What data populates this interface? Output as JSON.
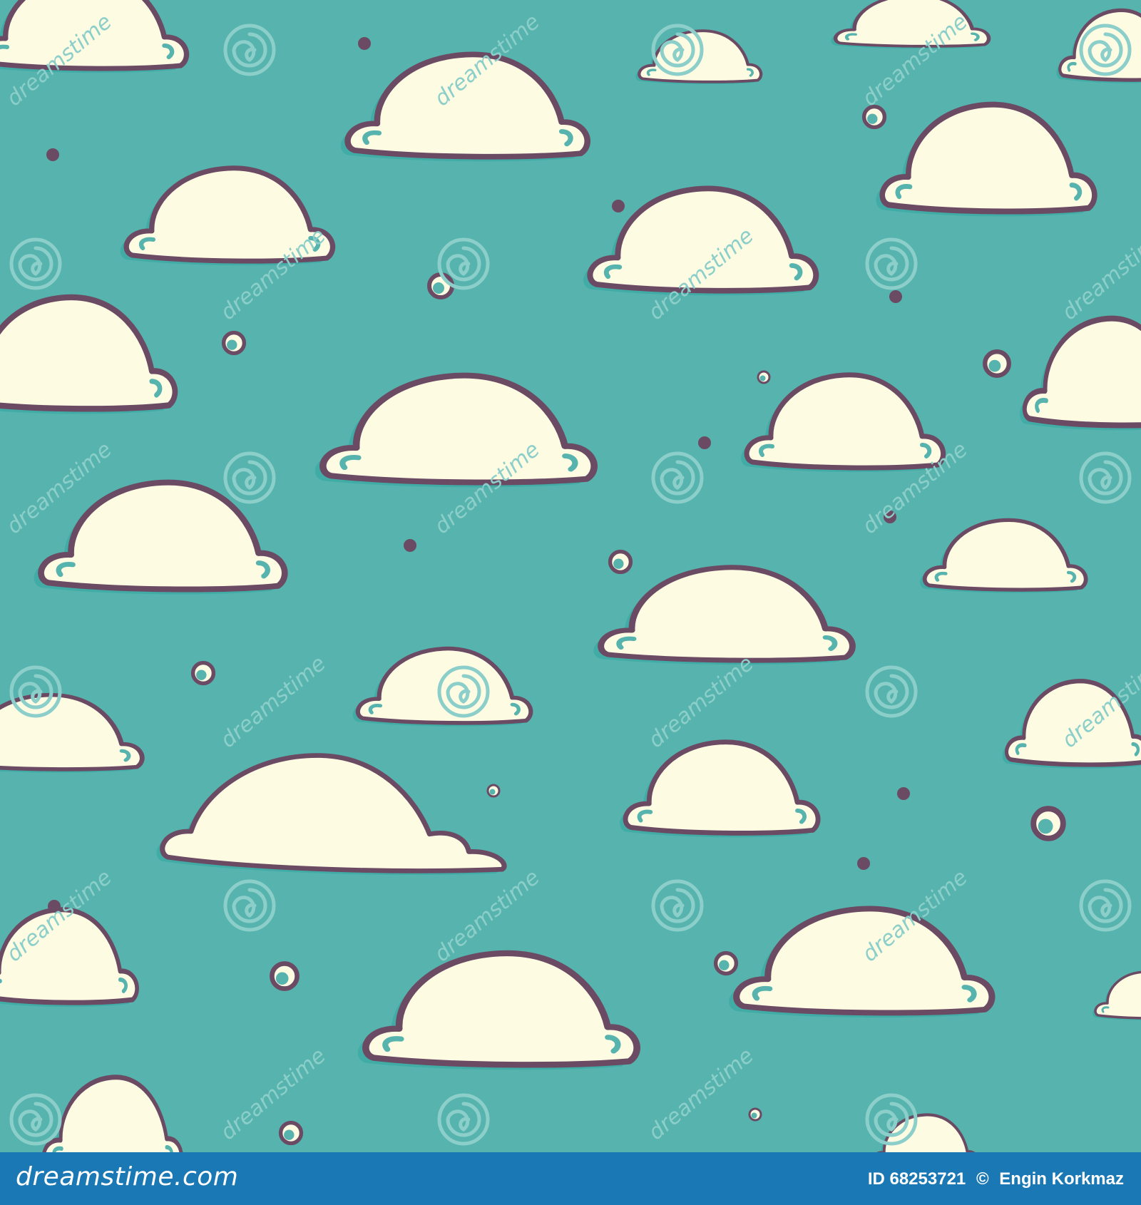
{
  "pattern": {
    "background_color": "#56b3ad",
    "cloud_fill": "#fdfbe2",
    "outline_color": "#6b4a64",
    "shadow_color": "#3fa9a4",
    "watermark_text": "dreamstime",
    "watermark_icon": "spiral-icon"
  },
  "footer": {
    "logo_text": "dreamstime.com",
    "id_label": "ID 68253721",
    "copyright": "©",
    "author": "Engin Korkmaz",
    "background_color": "#1a78b4"
  }
}
